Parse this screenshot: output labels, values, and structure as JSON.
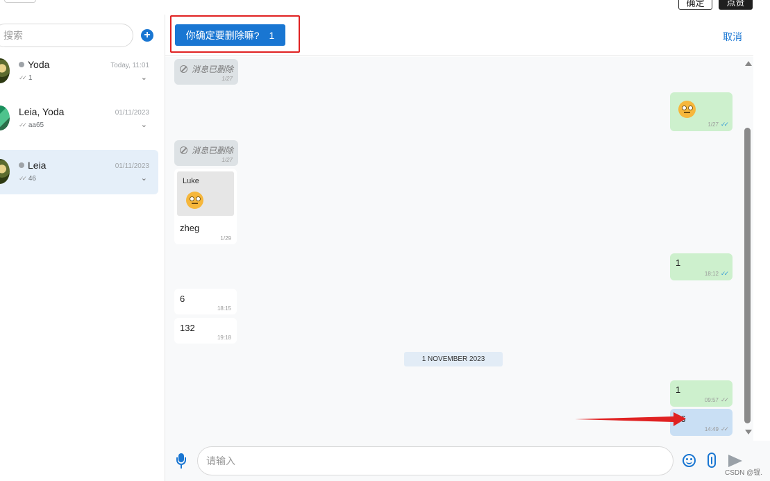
{
  "topbar": {
    "btn_light": "确定",
    "btn_dark": "点赞"
  },
  "sidebar": {
    "search_placeholder": "搜索",
    "add_icon": "plus-icon",
    "rooms": [
      {
        "title": "Yoda",
        "date": "Today, 11:01",
        "last": "1",
        "online_dot": true,
        "active": false
      },
      {
        "title": "Leia, Yoda",
        "date": "01/11/2023",
        "last": "aa65",
        "online_dot": false,
        "active": false
      },
      {
        "title": "Leia",
        "date": "01/11/2023",
        "last": "46",
        "online_dot": true,
        "active": true
      }
    ]
  },
  "header": {
    "delete_label": "你确定要删除嘛?",
    "delete_count": "1",
    "cancel_label": "取消"
  },
  "messages": [
    {
      "kind": "deleted",
      "text": "消息已删除",
      "time": "1/27"
    },
    {
      "kind": "out-emoji",
      "time": "1/27"
    },
    {
      "kind": "deleted",
      "text": "消息已删除",
      "time": "1/27"
    },
    {
      "kind": "in-reply",
      "reply_name": "Luke",
      "text": "zheg",
      "time": "1/29"
    },
    {
      "kind": "out",
      "text": "1",
      "time": "18:12"
    },
    {
      "kind": "in",
      "text": "6",
      "time": "18:15"
    },
    {
      "kind": "in",
      "text": "132",
      "time": "19:18"
    },
    {
      "kind": "date",
      "text": "1 NOVEMBER 2023"
    },
    {
      "kind": "out",
      "text": "1",
      "time": "09:57"
    },
    {
      "kind": "out-selected",
      "text": "46",
      "time": "14:49"
    }
  ],
  "footer": {
    "input_placeholder": "请输入"
  },
  "watermark": "CSDN @锟.",
  "colors": {
    "primary": "#1976d2",
    "outgoing_bubble": "#cdf0cd",
    "selected_bubble": "#c9dff4",
    "annotation_red": "#e02222"
  }
}
